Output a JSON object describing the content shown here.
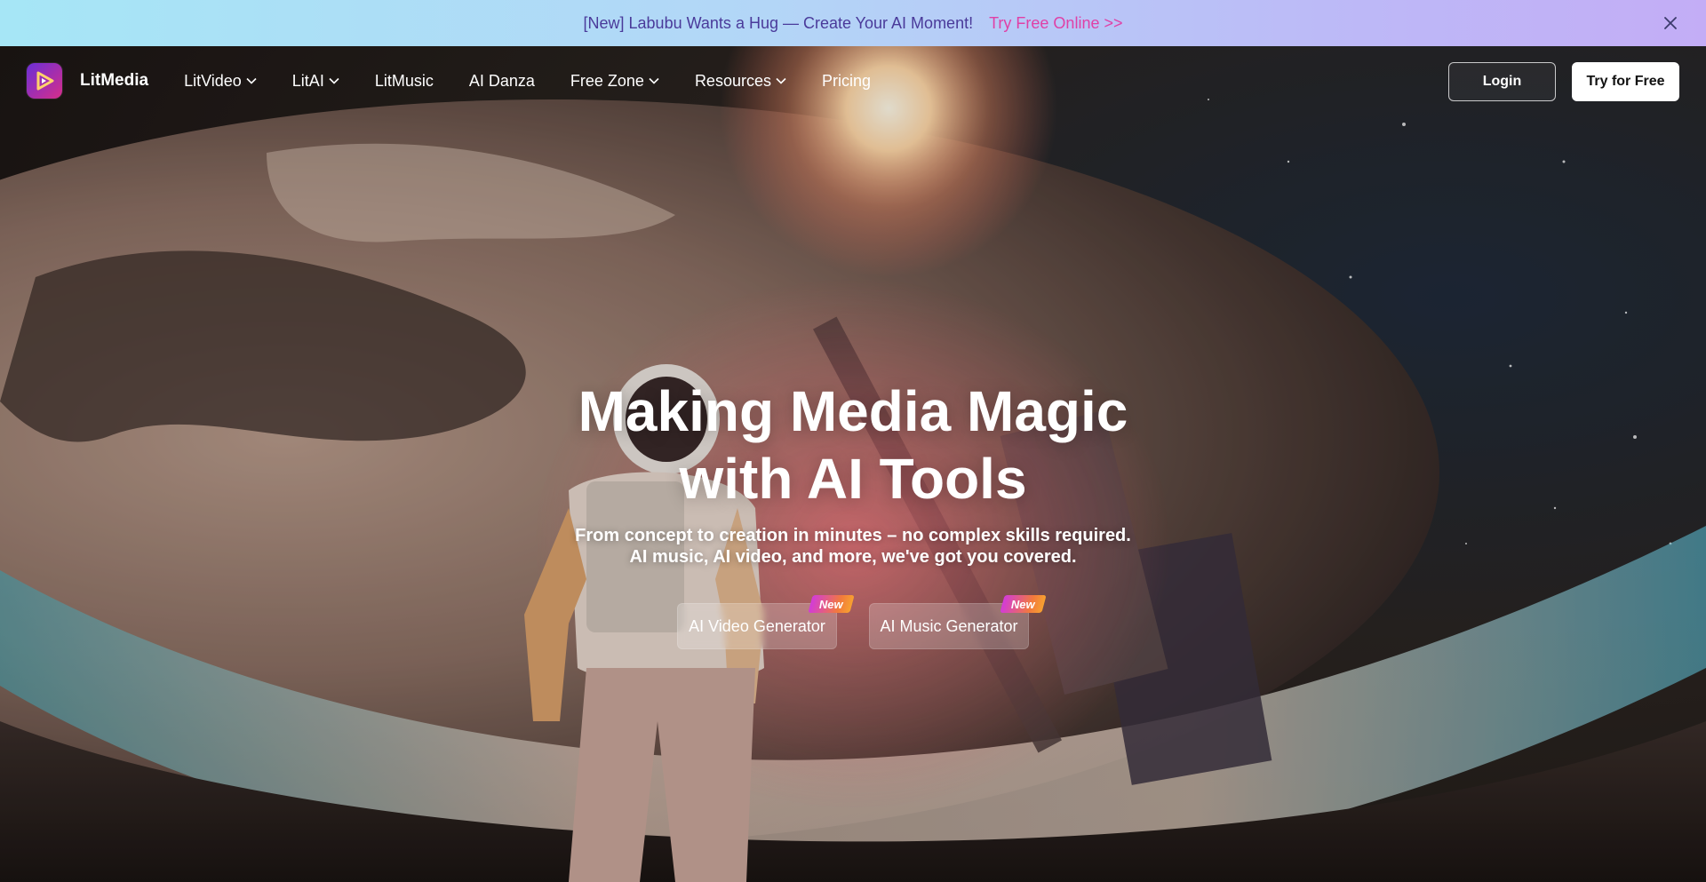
{
  "banner": {
    "text": "[New] Labubu Wants a Hug — Create Your AI Moment!",
    "link": "Try Free Online >>"
  },
  "nav": {
    "brand": "LitMedia",
    "items": [
      {
        "label": "LitVideo",
        "dropdown": true
      },
      {
        "label": "LitAI",
        "dropdown": true
      },
      {
        "label": "LitMusic",
        "dropdown": false
      },
      {
        "label": "AI Danza",
        "dropdown": false
      },
      {
        "label": "Free Zone",
        "dropdown": true
      },
      {
        "label": "Resources",
        "dropdown": true
      },
      {
        "label": "Pricing",
        "dropdown": false
      }
    ],
    "login": "Login",
    "try_free": "Try for Free"
  },
  "hero": {
    "title_line1": "Making Media Magic",
    "title_line2": "with AI Tools",
    "subtitle": "From concept to creation in minutes – no complex skills required. AI music, AI video, and more, we've got you covered.",
    "cta_video": "AI Video Generator",
    "cta_music": "AI Music Generator",
    "badge": "New"
  },
  "colors": {
    "banner_text": "#4a3a9a",
    "banner_link": "#e040a6",
    "brand_gradient_start": "#6b2fd6",
    "brand_gradient_end": "#d62e8a"
  }
}
